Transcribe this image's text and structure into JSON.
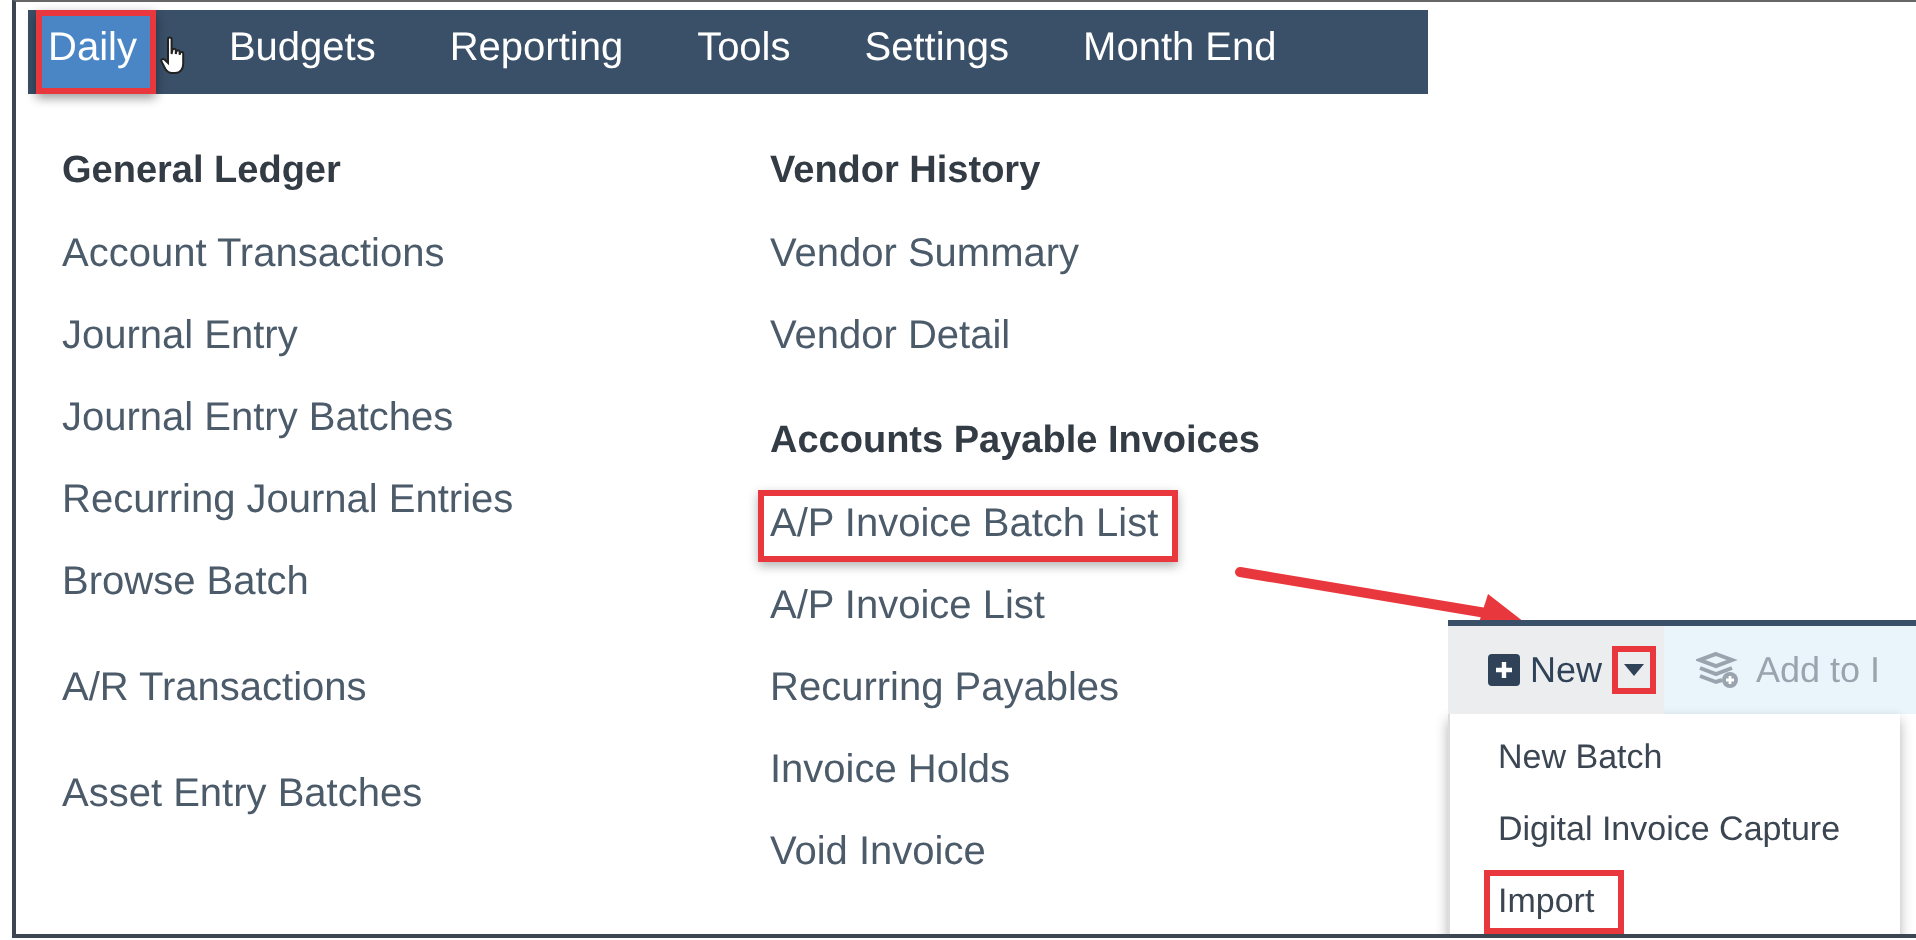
{
  "menu_bar": {
    "tabs": [
      {
        "label": "Daily",
        "selected": true,
        "highlighted": true
      },
      {
        "label": "Budgets",
        "selected": false,
        "highlighted": false
      },
      {
        "label": "Reporting",
        "selected": false,
        "highlighted": false
      },
      {
        "label": "Tools",
        "selected": false,
        "highlighted": false
      },
      {
        "label": "Settings",
        "selected": false,
        "highlighted": false
      },
      {
        "label": "Month End",
        "selected": false,
        "highlighted": false
      }
    ]
  },
  "menu_panel": {
    "columns": [
      {
        "groups": [
          {
            "heading": "General Ledger",
            "items": [
              {
                "label": "Account Transactions",
                "highlighted": false
              },
              {
                "label": "Journal Entry",
                "highlighted": false
              },
              {
                "label": "Journal Entry Batches",
                "highlighted": false
              },
              {
                "label": "Recurring Journal Entries",
                "highlighted": false
              },
              {
                "label": "Browse Batch",
                "highlighted": false
              }
            ]
          },
          {
            "items": [
              {
                "label": "A/R Transactions",
                "highlighted": false
              }
            ]
          },
          {
            "items": [
              {
                "label": "Asset Entry Batches",
                "highlighted": false
              }
            ]
          }
        ]
      },
      {
        "groups": [
          {
            "heading": "Vendor History",
            "items": [
              {
                "label": "Vendor Summary",
                "highlighted": false
              },
              {
                "label": "Vendor Detail",
                "highlighted": false
              }
            ]
          },
          {
            "heading": "Accounts Payable Invoices",
            "items": [
              {
                "label": "A/P Invoice Batch List",
                "highlighted": true
              },
              {
                "label": "A/P Invoice List",
                "highlighted": false
              },
              {
                "label": "Recurring Payables",
                "highlighted": false
              },
              {
                "label": "Invoice Holds",
                "highlighted": false
              },
              {
                "label": "Void Invoice",
                "highlighted": false
              }
            ]
          }
        ]
      }
    ]
  },
  "callout": {
    "toolbar": {
      "new_button": {
        "label": "New",
        "caret_highlighted": true
      },
      "add_button": {
        "label": "Add to I"
      }
    },
    "dropdown": [
      {
        "label": "New Batch",
        "highlighted": false
      },
      {
        "label": "Digital Invoice Capture",
        "highlighted": false
      },
      {
        "label": "Import",
        "highlighted": true
      }
    ]
  }
}
